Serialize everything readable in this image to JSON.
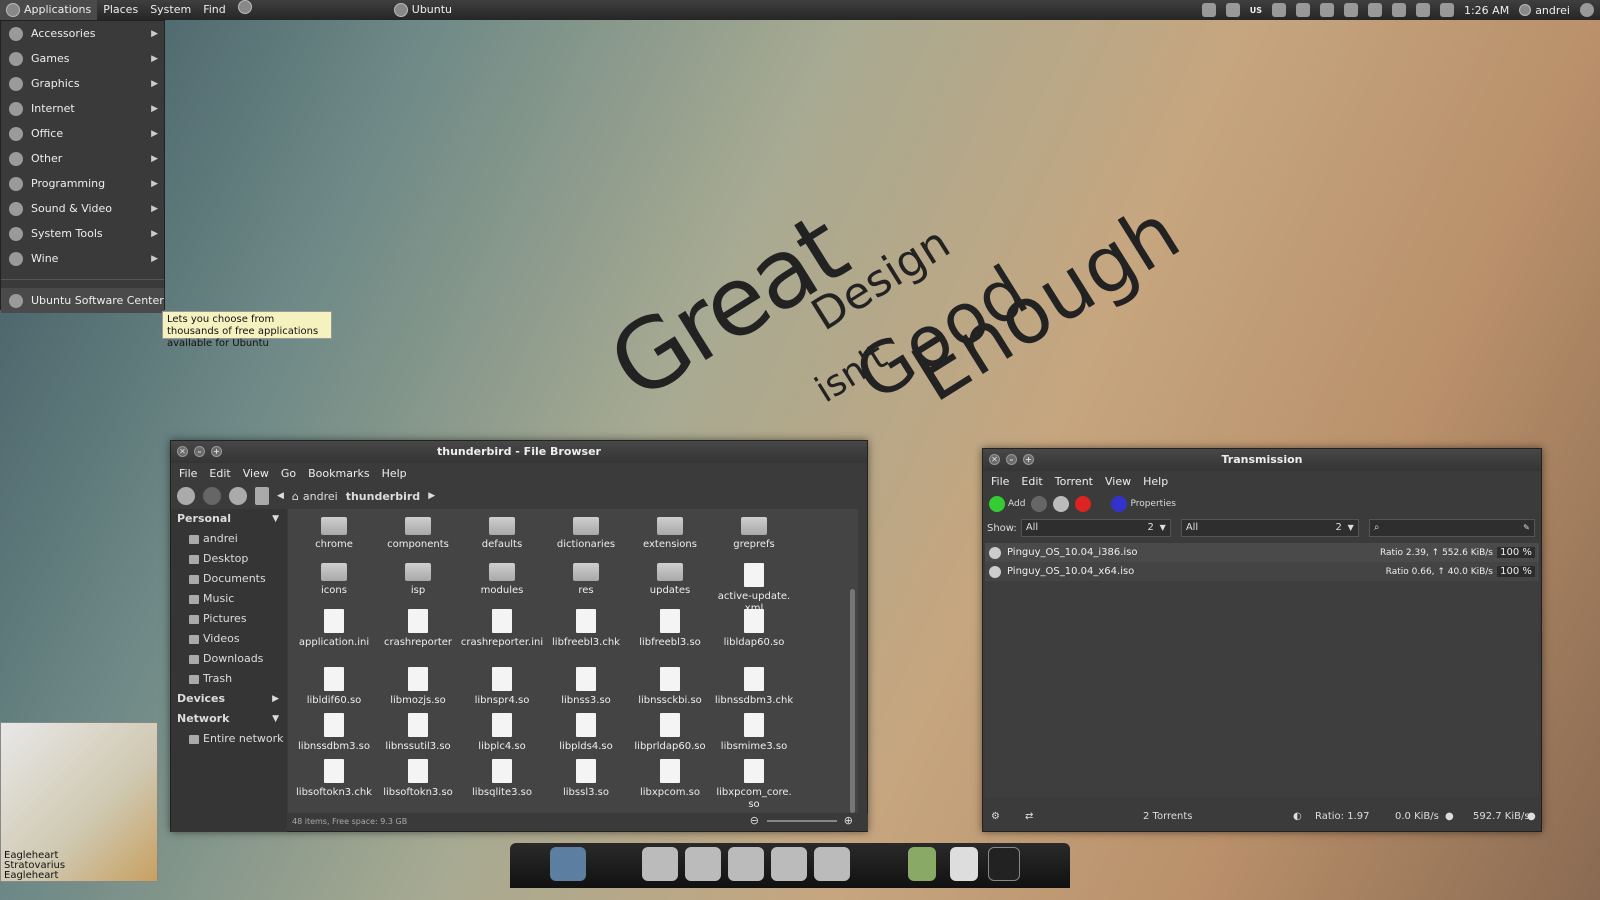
{
  "topbar": {
    "menus": [
      "Applications",
      "Places",
      "System",
      "Find"
    ],
    "workspace": "Ubuntu",
    "time": "1:26 AM",
    "user": "andrei",
    "kbd": "US"
  },
  "appmenu": {
    "items": [
      "Accessories",
      "Games",
      "Graphics",
      "Internet",
      "Office",
      "Other",
      "Programming",
      "Sound & Video",
      "System Tools",
      "Wine"
    ],
    "extra": "Ubuntu Software Center",
    "tooltip": "Lets you choose from thousands of free applications available for Ubuntu"
  },
  "wallpaper": {
    "w1": "Great",
    "w2": "Design",
    "w3": "isn't",
    "w4": "Good",
    "w5": "Enough"
  },
  "filebrowser": {
    "title": "thunderbird - File Browser",
    "menu": [
      "File",
      "Edit",
      "View",
      "Go",
      "Bookmarks",
      "Help"
    ],
    "path": [
      "andrei",
      "thunderbird"
    ],
    "sidebar": {
      "personal": "Personal",
      "places": [
        "andrei",
        "Desktop",
        "Documents",
        "Music",
        "Pictures",
        "Videos",
        "Downloads",
        "Trash"
      ],
      "devices": "Devices",
      "network": "Network",
      "network_items": [
        "Entire network"
      ]
    },
    "items": [
      {
        "name": "chrome",
        "kind": "folder"
      },
      {
        "name": "components",
        "kind": "folder"
      },
      {
        "name": "defaults",
        "kind": "folder"
      },
      {
        "name": "dictionaries",
        "kind": "folder"
      },
      {
        "name": "extensions",
        "kind": "folder"
      },
      {
        "name": "greprefs",
        "kind": "folder"
      },
      {
        "name": "icons",
        "kind": "folder"
      },
      {
        "name": "isp",
        "kind": "folder"
      },
      {
        "name": "modules",
        "kind": "folder"
      },
      {
        "name": "res",
        "kind": "folder"
      },
      {
        "name": "updates",
        "kind": "folder"
      },
      {
        "name": "active-update.\nxml",
        "kind": "file"
      },
      {
        "name": "application.ini",
        "kind": "file"
      },
      {
        "name": "crashreporter",
        "kind": "file"
      },
      {
        "name": "crashreporter.ini",
        "kind": "file"
      },
      {
        "name": "libfreebl3.chk",
        "kind": "file"
      },
      {
        "name": "libfreebl3.so",
        "kind": "file"
      },
      {
        "name": "libldap60.so",
        "kind": "file"
      },
      {
        "name": "libldif60.so",
        "kind": "file"
      },
      {
        "name": "libmozjs.so",
        "kind": "file"
      },
      {
        "name": "libnspr4.so",
        "kind": "file"
      },
      {
        "name": "libnss3.so",
        "kind": "file"
      },
      {
        "name": "libnssckbi.so",
        "kind": "file"
      },
      {
        "name": "libnssdbm3.chk",
        "kind": "file"
      },
      {
        "name": "libnssdbm3.so",
        "kind": "file"
      },
      {
        "name": "libnssutil3.so",
        "kind": "file"
      },
      {
        "name": "libplc4.so",
        "kind": "file"
      },
      {
        "name": "libplds4.so",
        "kind": "file"
      },
      {
        "name": "libprldap60.so",
        "kind": "file"
      },
      {
        "name": "libsmime3.so",
        "kind": "file"
      },
      {
        "name": "libsoftokn3.chk",
        "kind": "file"
      },
      {
        "name": "libsoftokn3.so",
        "kind": "file"
      },
      {
        "name": "libsqlite3.so",
        "kind": "file"
      },
      {
        "name": "libssl3.so",
        "kind": "file"
      },
      {
        "name": "libxpcom.so",
        "kind": "file"
      },
      {
        "name": "libxpcom_core.\nso",
        "kind": "file"
      }
    ],
    "status": "48 items, Free space: 9.3 GB"
  },
  "transmission": {
    "title": "Transmission",
    "menu": [
      "File",
      "Edit",
      "Torrent",
      "View",
      "Help"
    ],
    "toolbar": {
      "add": "Add",
      "properties": "Properties"
    },
    "filter": {
      "show_label": "Show:",
      "f1": "All",
      "n1": "2",
      "f2": "All",
      "n2": "2"
    },
    "torrents": [
      {
        "name": "Pinguy_OS_10.04_i386.iso",
        "stats": "Ratio 2.39, ↑ 552.6 KiB/s",
        "pct": "100 %"
      },
      {
        "name": "Pinguy_OS_10.04_x64.iso",
        "stats": "Ratio 0.66, ↑ 40.0 KiB/s",
        "pct": "100 %"
      }
    ],
    "status": {
      "count": "2 Torrents",
      "ratio": "Ratio: 1.97",
      "down": "0.0 KiB/s",
      "up": "592.7 KiB/s"
    }
  },
  "desklet": {
    "caption": "Eagleheart\nStratovarius\nEagleheart"
  }
}
